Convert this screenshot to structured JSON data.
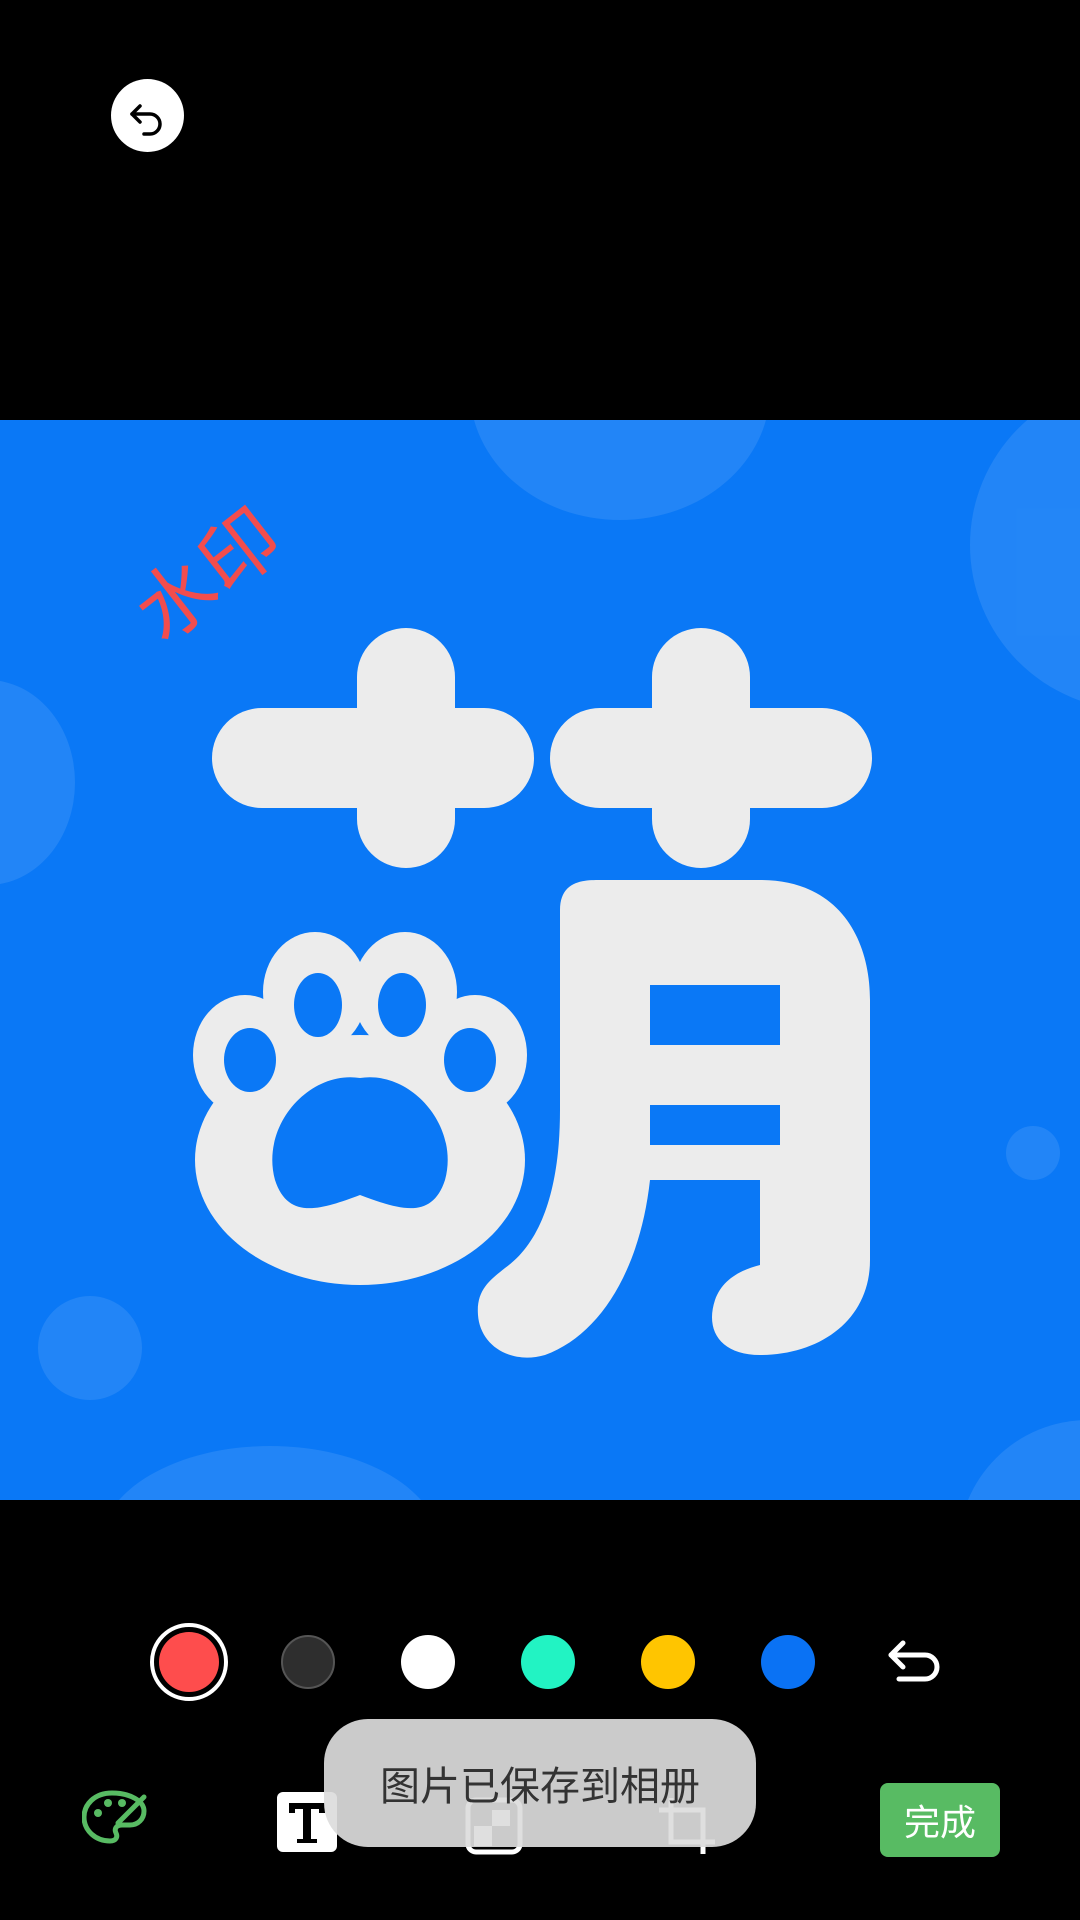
{
  "watermark": {
    "text": "水印",
    "color": "#f24d4d"
  },
  "canvas": {
    "background": "#0a78f6",
    "glyph_color": "#ececec"
  },
  "palette": {
    "colors": [
      {
        "name": "red",
        "hex": "#fe4d4d",
        "selected": true
      },
      {
        "name": "dark-gray",
        "hex": "#2e2e2e",
        "selected": false
      },
      {
        "name": "white",
        "hex": "#ffffff",
        "selected": false
      },
      {
        "name": "teal",
        "hex": "#22f3c3",
        "selected": false
      },
      {
        "name": "yellow",
        "hex": "#ffc500",
        "selected": false
      },
      {
        "name": "blue",
        "hex": "#0a72f4",
        "selected": false
      }
    ]
  },
  "toolbar": {
    "done_label": "完成",
    "accent": "#58bb63"
  },
  "toast": {
    "message": "图片已保存到相册"
  },
  "icons": {
    "back": "back-arrow-icon",
    "undo": "undo-icon",
    "paint": "palette-icon",
    "text": "text-icon",
    "mosaic": "mosaic-icon",
    "crop": "crop-icon"
  }
}
